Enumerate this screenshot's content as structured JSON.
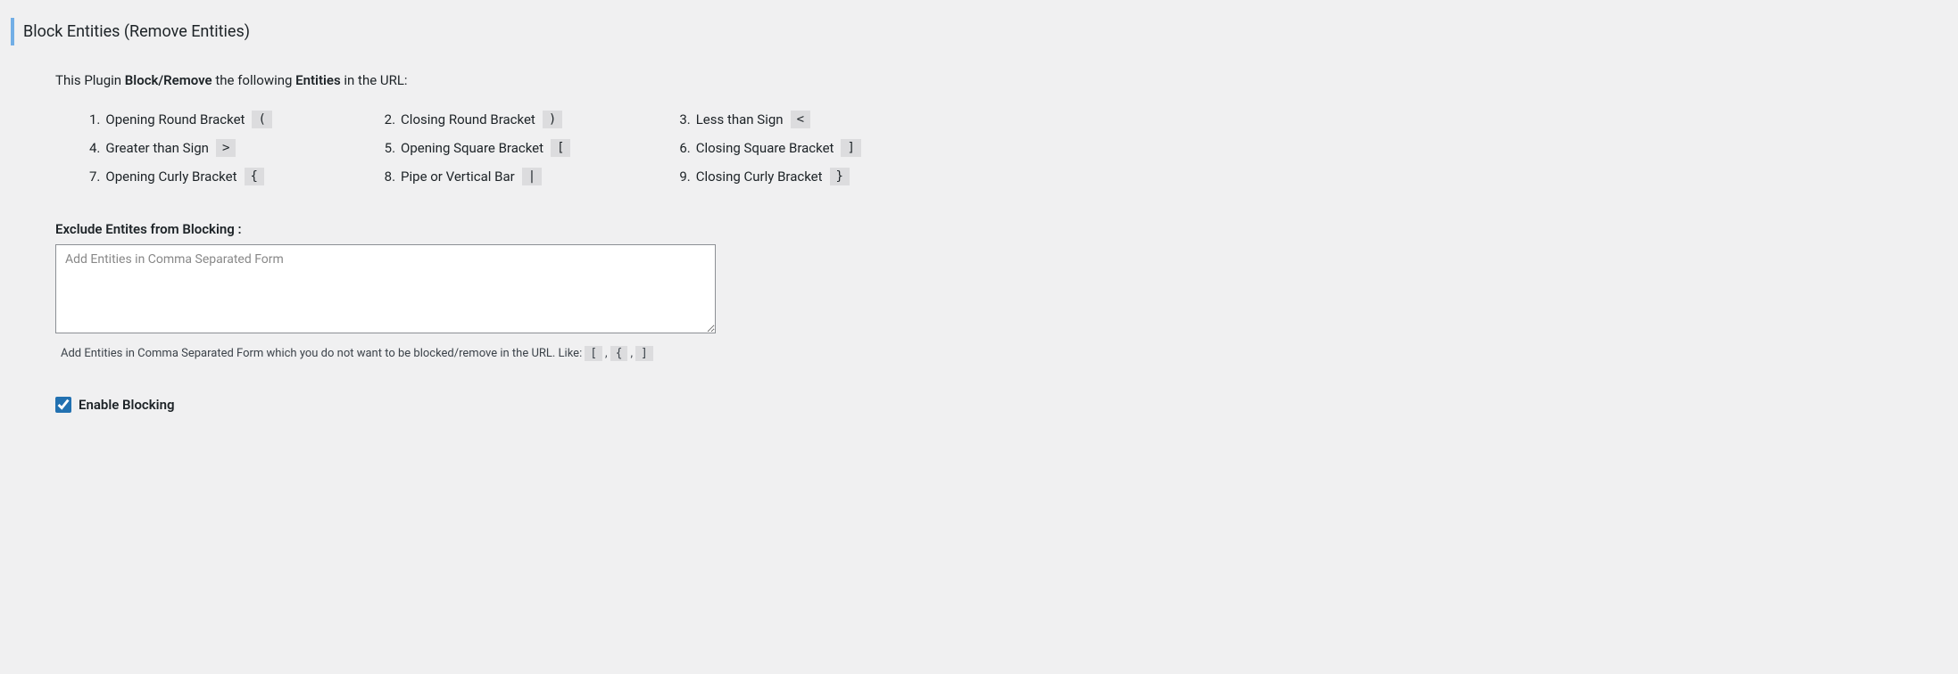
{
  "section": {
    "title": "Block Entities (Remove Entities)"
  },
  "intro": {
    "prefix": "This Plugin ",
    "bold1": "Block/Remove",
    "mid": " the following ",
    "bold2": "Entities",
    "suffix": " in the URL:"
  },
  "entities": [
    {
      "num": "1.",
      "label": "Opening Round Bracket",
      "symbol": "("
    },
    {
      "num": "2.",
      "label": "Closing Round Bracket",
      "symbol": ")"
    },
    {
      "num": "3.",
      "label": "Less than Sign",
      "symbol": "<"
    },
    {
      "num": "4.",
      "label": "Greater than Sign",
      "symbol": ">"
    },
    {
      "num": "5.",
      "label": "Opening Square Bracket",
      "symbol": "["
    },
    {
      "num": "6.",
      "label": "Closing Square Bracket",
      "symbol": "]"
    },
    {
      "num": "7.",
      "label": "Opening Curly Bracket",
      "symbol": "{"
    },
    {
      "num": "8.",
      "label": "Pipe or Vertical Bar",
      "symbol": "|"
    },
    {
      "num": "9.",
      "label": "Closing Curly Bracket",
      "symbol": "}"
    }
  ],
  "exclude": {
    "label": "Exclude Entites from Blocking :",
    "placeholder": "Add Entities in Comma Separated Form",
    "helper_prefix": "Add Entities in Comma Separated Form which you do not want to be blocked/remove in the URL. Like:",
    "helper_symbols": [
      "[",
      "{",
      "]"
    ],
    "helper_sep": ","
  },
  "enable": {
    "label": "Enable Blocking",
    "checked": true
  }
}
